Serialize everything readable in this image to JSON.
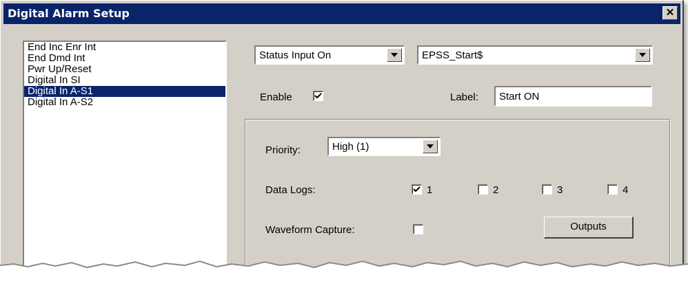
{
  "window": {
    "title": "Digital Alarm Setup",
    "close_label": "✕"
  },
  "alarm_list": {
    "items": [
      "End Inc Enr Int",
      "End Dmd Int",
      "Pwr Up/Reset",
      "Digital In SI",
      "Digital In A-S1",
      "Digital In A-S2"
    ],
    "selected_index": 4
  },
  "condition_select": {
    "value": "Status Input On"
  },
  "point_select": {
    "value": "EPSS_Start$"
  },
  "enable": {
    "label": "Enable",
    "checked": true
  },
  "label_field": {
    "label": "Label:",
    "value": "Start ON"
  },
  "priority": {
    "label": "Priority:",
    "value": "High (1)"
  },
  "data_logs": {
    "label": "Data Logs:",
    "options": [
      {
        "label": "1",
        "checked": true
      },
      {
        "label": "2",
        "checked": false
      },
      {
        "label": "3",
        "checked": false
      },
      {
        "label": "4",
        "checked": false
      }
    ]
  },
  "waveform": {
    "label": "Waveform Capture:",
    "checked": false
  },
  "outputs_button": {
    "label": "Outputs"
  }
}
